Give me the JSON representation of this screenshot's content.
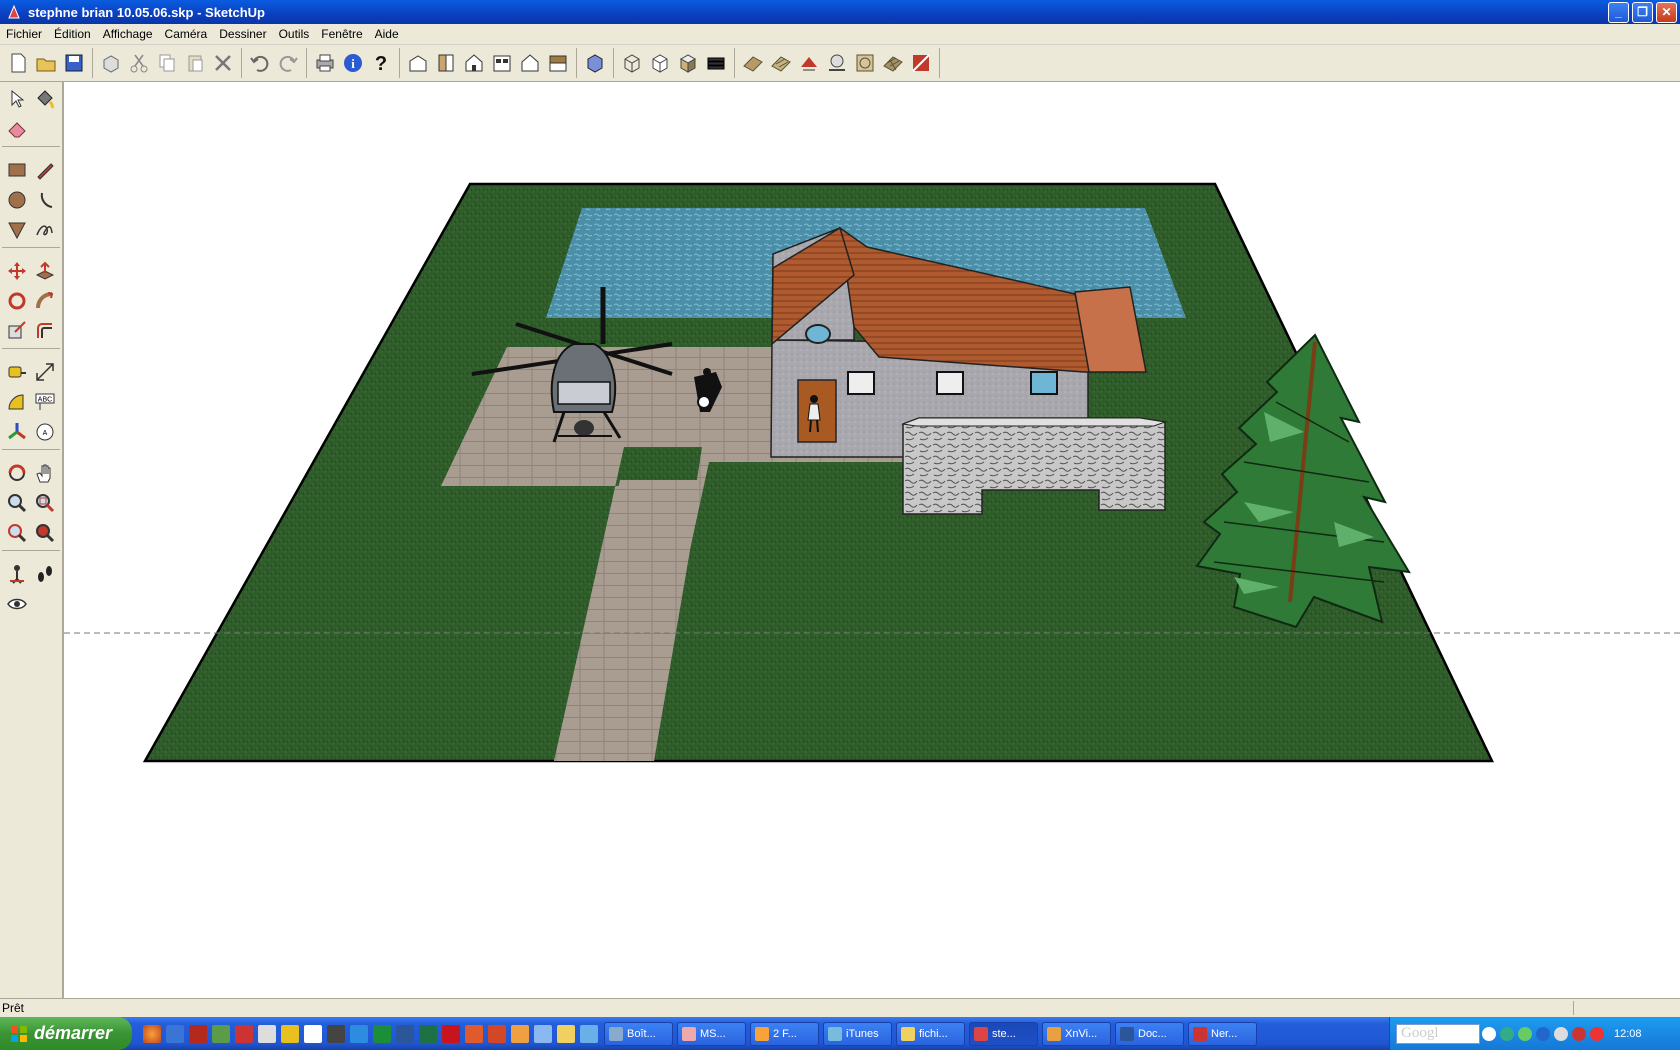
{
  "window": {
    "title": "stephne brian 10.05.06.skp - SketchUp"
  },
  "menubar": {
    "items": [
      "Fichier",
      "Édition",
      "Affichage",
      "Caméra",
      "Dessiner",
      "Outils",
      "Fenêtre",
      "Aide"
    ]
  },
  "statusbar": {
    "status": "Prêt"
  },
  "taskbar": {
    "start_label": "démarrer",
    "tasks": [
      "Boît...",
      "MS...",
      "2 F...",
      "iTunes",
      "fichi...",
      "ste...",
      "XnVi...",
      "Doc...",
      "Ner..."
    ],
    "search_logo": "Googl",
    "clock": "12:08"
  },
  "colors": {
    "grass": "#2f5a2a",
    "pool": "#4d93b0",
    "path": "#a89c90",
    "roof": "#b0562e",
    "wall": "#a9a9a9",
    "tree": "#2f7a36",
    "titlebar": "#0b3fbf"
  }
}
